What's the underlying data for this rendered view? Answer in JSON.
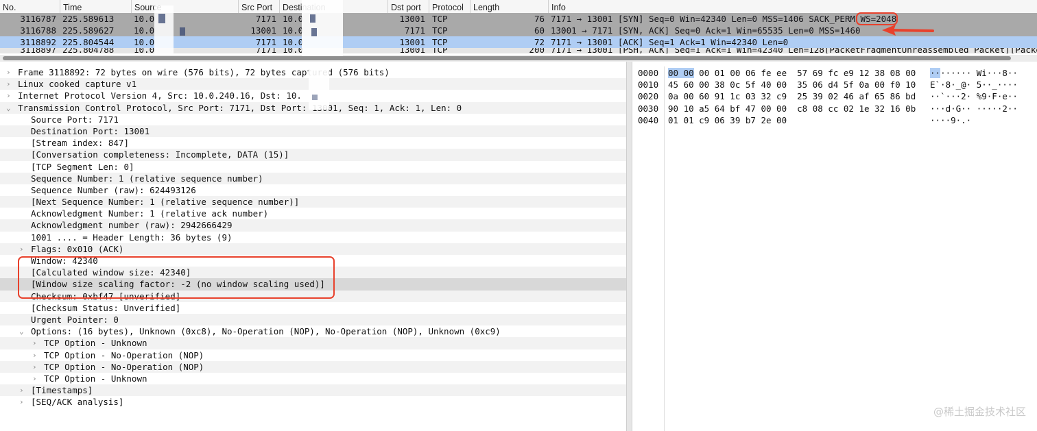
{
  "packet_list": {
    "columns": [
      "No.",
      "Time",
      "Source",
      "Src Port",
      "Destination",
      "Dst port",
      "Protocol",
      "Length",
      "Info"
    ],
    "rows": [
      {
        "no": "3116787",
        "time": "225.589613",
        "source": "10.0",
        "sport": "7171",
        "dest": "10.0",
        "dport": "13001",
        "proto": "TCP",
        "len": "76",
        "info": "7171 → 13001 [SYN] Seq=0 Win=42340 Len=0 MSS=1406 SACK_PERM WS=2048"
      },
      {
        "no": "3116788",
        "time": "225.589627",
        "source": "10.0",
        "sport": "13001",
        "dest": "10.0",
        "dport": "7171",
        "proto": "TCP",
        "len": "60",
        "info": "13001 → 7171 [SYN, ACK] Seq=0 Ack=1 Win=65535 Len=0 MSS=1460"
      },
      {
        "no": "3118892",
        "time": "225.804544",
        "source": "10.0",
        "sport": "7171",
        "dest": "10.0",
        "dport": "13001",
        "proto": "TCP",
        "len": "72",
        "info": "7171 → 13001 [ACK] Seq=1 Ack=1 Win=42340 Len=0"
      },
      {
        "no": "3118897",
        "time": "225.804788",
        "source": "10.0",
        "sport": "7171",
        "dest": "10.0",
        "dport": "13001",
        "proto": "TCP",
        "len": "200",
        "info": "7171 → 13001 [PSH, ACK] Seq=1 Ack=1 Win=42340 Len=128[PacketFragmentUnreassembled Packet][PacketFrag"
      }
    ]
  },
  "details": [
    {
      "indent": 0,
      "arrow": "›",
      "text": "Frame 3118892: 72 bytes on wire (576 bits), 72 bytes captured (576 bits)"
    },
    {
      "indent": 0,
      "arrow": "›",
      "text": "Linux cooked capture v1"
    },
    {
      "indent": 0,
      "arrow": "›",
      "text": "Internet Protocol Version 4, Src: 10.0.240.16, Dst: 10."
    },
    {
      "indent": 0,
      "arrow": "⌄",
      "text": "Transmission Control Protocol, Src Port: 7171, Dst Port: 13001, Seq: 1, Ack: 1, Len: 0"
    },
    {
      "indent": 1,
      "arrow": "",
      "text": "Source Port: 7171"
    },
    {
      "indent": 1,
      "arrow": "",
      "text": "Destination Port: 13001"
    },
    {
      "indent": 1,
      "arrow": "",
      "text": "[Stream index: 847]"
    },
    {
      "indent": 1,
      "arrow": "",
      "text": "[Conversation completeness: Incomplete, DATA (15)]"
    },
    {
      "indent": 1,
      "arrow": "",
      "text": "[TCP Segment Len: 0]"
    },
    {
      "indent": 1,
      "arrow": "",
      "text": "Sequence Number: 1    (relative sequence number)"
    },
    {
      "indent": 1,
      "arrow": "",
      "text": "Sequence Number (raw): 624493126"
    },
    {
      "indent": 1,
      "arrow": "",
      "text": "[Next Sequence Number: 1    (relative sequence number)]"
    },
    {
      "indent": 1,
      "arrow": "",
      "text": "Acknowledgment Number: 1    (relative ack number)"
    },
    {
      "indent": 1,
      "arrow": "",
      "text": "Acknowledgment number (raw): 2942666429"
    },
    {
      "indent": 1,
      "arrow": "",
      "text": "1001 .... = Header Length: 36 bytes (9)"
    },
    {
      "indent": 1,
      "arrow": "›",
      "text": "Flags: 0x010 (ACK)"
    },
    {
      "indent": 1,
      "arrow": "",
      "text": "Window: 42340"
    },
    {
      "indent": 1,
      "arrow": "",
      "text": "[Calculated window size: 42340]"
    },
    {
      "indent": 1,
      "arrow": "",
      "text": "[Window size scaling factor: -2 (no window scaling used)]",
      "selected": true
    },
    {
      "indent": 1,
      "arrow": "",
      "text": "Checksum: 0xbf47 [unverified]"
    },
    {
      "indent": 1,
      "arrow": "",
      "text": "[Checksum Status: Unverified]"
    },
    {
      "indent": 1,
      "arrow": "",
      "text": "Urgent Pointer: 0"
    },
    {
      "indent": 1,
      "arrow": "⌄",
      "text": "Options: (16 bytes), Unknown (0xc8), No-Operation (NOP), No-Operation (NOP), Unknown (0xc9)"
    },
    {
      "indent": 2,
      "arrow": "›",
      "text": "TCP Option - Unknown"
    },
    {
      "indent": 2,
      "arrow": "›",
      "text": "TCP Option - No-Operation (NOP)"
    },
    {
      "indent": 2,
      "arrow": "›",
      "text": "TCP Option - No-Operation (NOP)"
    },
    {
      "indent": 2,
      "arrow": "›",
      "text": "TCP Option - Unknown"
    },
    {
      "indent": 1,
      "arrow": "›",
      "text": "[Timestamps]"
    },
    {
      "indent": 1,
      "arrow": "›",
      "text": "[SEQ/ACK analysis]"
    }
  ],
  "bytes": [
    {
      "offset": "0000",
      "hex": "00 00 00 01 00 06 fe ee  57 69 fc e9 12 38 08 00",
      "ascii": "········ Wi···8··"
    },
    {
      "offset": "0010",
      "hex": "45 60 00 38 0c 5f 40 00  35 06 d4 5f 0a 00 f0 10",
      "ascii": "E`·8·_@· 5··_····"
    },
    {
      "offset": "0020",
      "hex": "0a 00 60 91 1c 03 32 c9  25 39 02 46 af 65 86 bd",
      "ascii": "··`···2· %9·F·e··"
    },
    {
      "offset": "0030",
      "hex": "90 10 a5 64 bf 47 00 00  c8 08 cc 02 1e 32 16 0b",
      "ascii": "···d·G·· ·····2··"
    },
    {
      "offset": "0040",
      "hex": "01 01 c9 06 39 b7 2e 00",
      "ascii": "····9·.·"
    }
  ],
  "watermark": "@稀土掘金技术社区"
}
